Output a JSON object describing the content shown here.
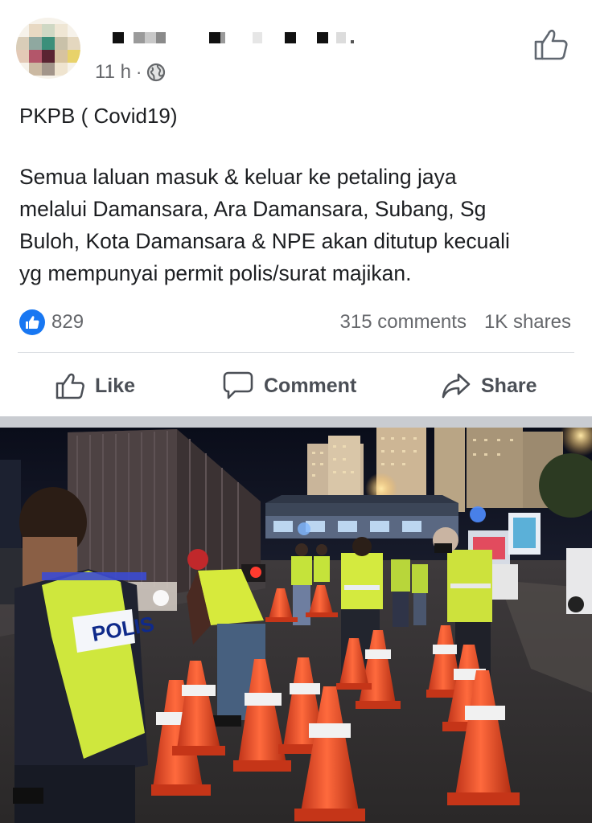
{
  "post": {
    "timestamp": "11 h",
    "separator": "·",
    "title": "PKPB ( Covid19)",
    "body_lines": [
      "Semua laluan masuk & keluar ke petaling jaya",
      "melalui Damansara, Ara Damansara, Subang, Sg",
      "Buloh, Kota Damansara & NPE akan ditutup kecuali",
      "yg mempunyai permit polis/surat majikan."
    ]
  },
  "stats": {
    "reactions": "829",
    "comments": "315 comments",
    "shares": "1K shares"
  },
  "actions": {
    "like": "Like",
    "comment": "Comment",
    "share": "Share"
  },
  "photo": {
    "vest_text": "POLIS"
  },
  "icons": {
    "privacy": "globe-icon",
    "header_like": "thumbs-up-outline-icon",
    "reaction": "like-reaction-icon",
    "like": "thumbs-up-outline-icon",
    "comment": "speech-bubble-icon",
    "share": "share-arrow-icon"
  },
  "colors": {
    "facebook_blue": "#1877f2",
    "secondary_text": "#65676b",
    "primary_text": "#1c1e21",
    "action_text": "#4b4f56",
    "divider": "#dadde1"
  }
}
